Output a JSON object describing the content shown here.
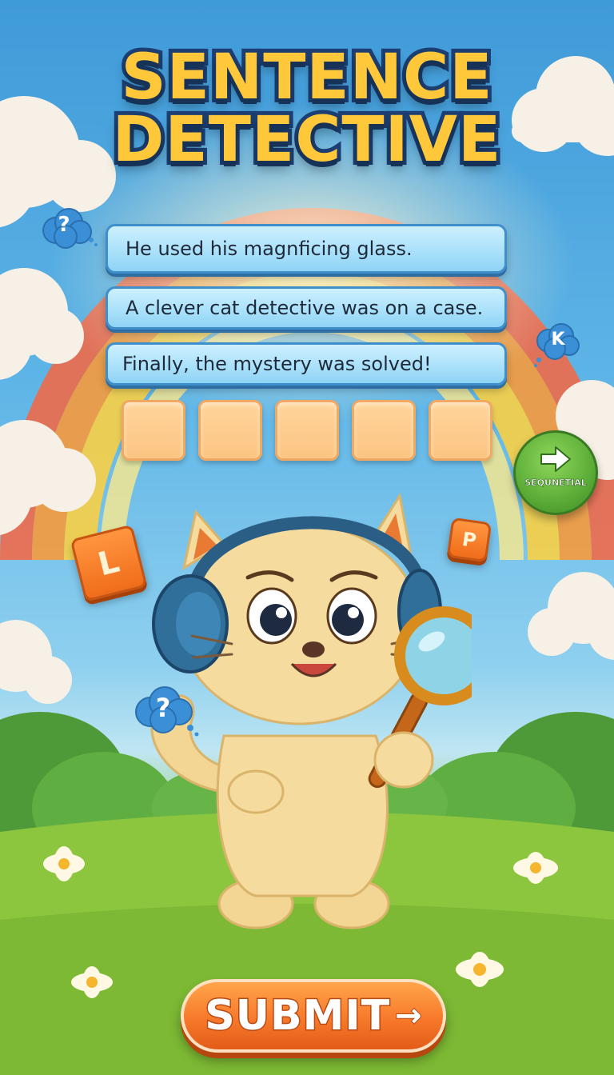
{
  "title": {
    "line1": "SENTENCE",
    "line2": "DETECTIVE"
  },
  "sentences": [
    "He used his magnficing glass.",
    "A clever cat detective was on a case.",
    "Finally, the mystery was solved!"
  ],
  "answer_slots": 5,
  "next_button": {
    "label": "SEQUNETIAL",
    "icon": "arrow-right-icon"
  },
  "letter_tiles": [
    "L",
    "P",
    "K"
  ],
  "thought_bubbles": [
    "?",
    "?"
  ],
  "submit_button": {
    "label": "SUBMIT",
    "arrow": "→"
  },
  "colors": {
    "title_fill": "#ffc73a",
    "title_outline": "#1d3f73",
    "card_fill": "#a8e0fa",
    "slot_fill": "#fbc583",
    "next_green": "#5fb03a",
    "submit_orange": "#f7792b"
  }
}
